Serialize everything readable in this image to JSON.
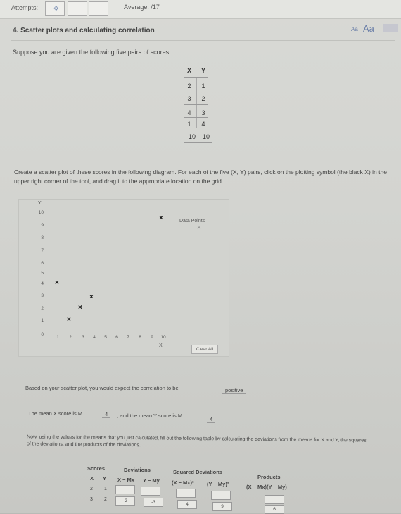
{
  "header": {
    "attempts_label": "Attempts:",
    "attempt_icon": "diamond-icon",
    "average_label": "Average: /17"
  },
  "question": {
    "title": "4. Scatter plots and calculating correlation",
    "font_small": "Aa",
    "font_large": "Aa",
    "intro": "Suppose you are given the following five pairs of scores:",
    "pairs_header": {
      "x": "X",
      "y": "Y"
    },
    "pairs": [
      {
        "x": "2",
        "y": "1"
      },
      {
        "x": "3",
        "y": "2"
      },
      {
        "x": "4",
        "y": "3"
      },
      {
        "x": "1",
        "y": "4"
      },
      {
        "x": "10",
        "y": "10"
      }
    ],
    "instructions": "Create a scatter plot of these scores in the following diagram. For each of the five (X, Y) pairs, click on the plotting symbol (the black X) in the upper right corner of the tool, and drag it to the appropriate location on the grid."
  },
  "plot": {
    "y_title": "Y",
    "x_title": "X",
    "y_ticks": [
      "10",
      "9",
      "8",
      "7",
      "6",
      "5",
      "4",
      "3",
      "2",
      "1",
      "0"
    ],
    "x_ticks": [
      "1",
      "2",
      "3",
      "4",
      "5",
      "6",
      "7",
      "8",
      "9",
      "10"
    ],
    "data_points_label": "Data Points",
    "symbol": "×",
    "placed_points": [
      {
        "x": 1,
        "y": 4
      },
      {
        "x": 2,
        "y": 1
      },
      {
        "x": 3,
        "y": 2
      },
      {
        "x": 4,
        "y": 3
      },
      {
        "x": 10,
        "y": 10
      }
    ],
    "clear_label": "Clear All"
  },
  "correlation": {
    "prompt": "Based on your scatter plot, you would expect the correlation to be",
    "answer": "positive"
  },
  "means": {
    "part1": "The mean X score is M",
    "mx": "4",
    "part2": ", and the mean Y score is M",
    "my": "4"
  },
  "calc": {
    "paragraph": "Now, using the values for the means that you just calculated, fill out the following table by calculating the deviations from the means for X and Y, the squares of the deviations, and the products of the deviations.",
    "headers": {
      "scores": "Scores",
      "deviations": "Deviations",
      "squared": "Squared Deviations",
      "products": "Products",
      "x": "X",
      "y": "Y",
      "dev_x": "X − Mx",
      "dev_y": "Y − My",
      "sq_x": "(X − Mx)²",
      "sq_y": "(Y − My)²",
      "prod": "(X − Mx)(Y − My)"
    },
    "rows": [
      {
        "x": "2",
        "y": "1",
        "dev_x": "",
        "dev_y": "",
        "sq_x": "",
        "sq_y": "",
        "prod": ""
      },
      {
        "x": "3",
        "y": "2",
        "dev_x": "-2",
        "dev_y": "-3",
        "sq_x": "4",
        "sq_y": "9",
        "prod": "6"
      }
    ]
  }
}
